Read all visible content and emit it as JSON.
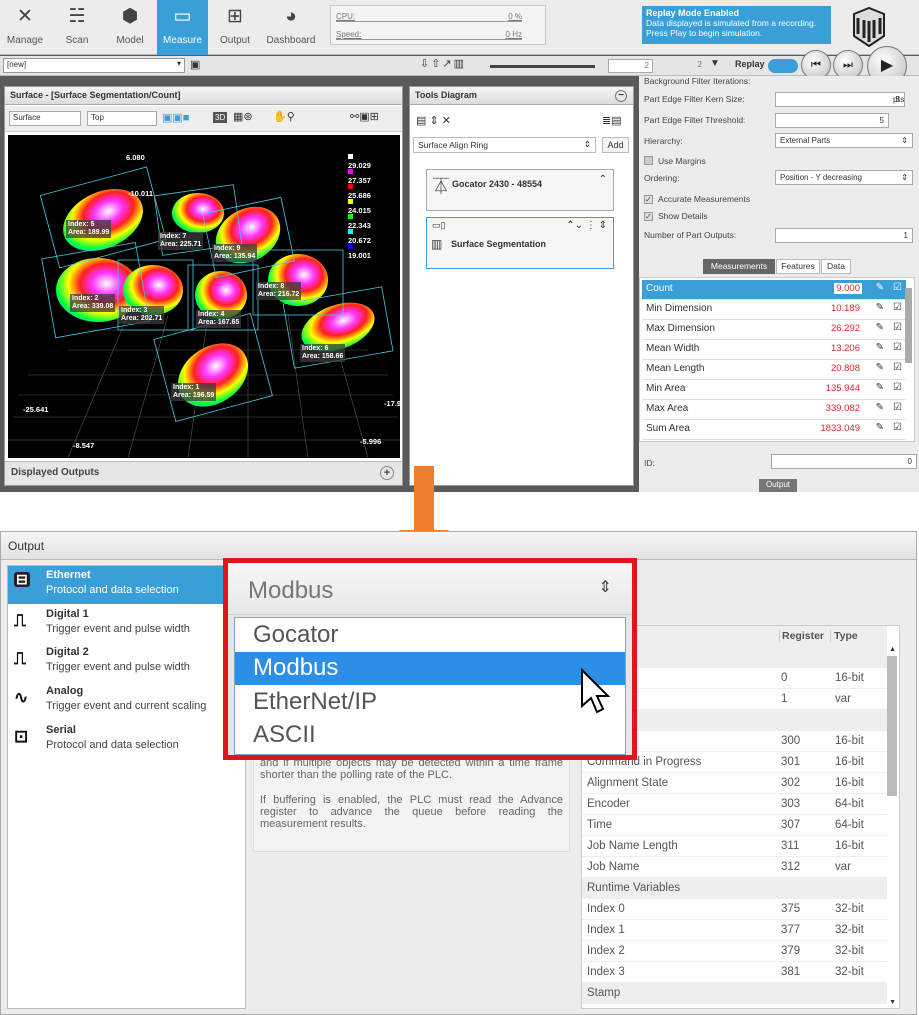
{
  "nav": [
    {
      "label": "Manage",
      "icon": "tools-icon"
    },
    {
      "label": "Scan",
      "icon": "scan-icon"
    },
    {
      "label": "Model",
      "icon": "model-icon"
    },
    {
      "label": "Measure",
      "icon": "measure-icon"
    },
    {
      "label": "Output",
      "icon": "output-icon"
    },
    {
      "label": "Dashboard",
      "icon": "dashboard-icon"
    }
  ],
  "stats": {
    "cpu_label": "CPU:",
    "cpu_value": "0 %",
    "speed_label": "Speed:",
    "speed_value": "0 Hz"
  },
  "replay": {
    "title": "Replay Mode Enabled",
    "message": "Data displayed is simulated from a recording. Press Play to begin simulation.",
    "toggle_label": "Replay"
  },
  "job": {
    "value": "[new]"
  },
  "frame": {
    "current": "2",
    "total": "2"
  },
  "viewer": {
    "title": "Surface - [Surface Segmentation/Count]",
    "source": "Surface",
    "view": "Top",
    "mode3d": "3D",
    "footer": "Displayed Outputs",
    "legend": [
      {
        "value": "29.029",
        "color": "#ffffff"
      },
      {
        "value": "27.357",
        "color": "#ff00ff"
      },
      {
        "value": "25.686",
        "color": "#ff0000"
      },
      {
        "value": "24.015",
        "color": "#ffff00"
      },
      {
        "value": "22.343",
        "color": "#00ff00"
      },
      {
        "value": "20.672",
        "color": "#00ffff"
      },
      {
        "value": "19.001",
        "color": "#0000ff"
      }
    ],
    "axes": {
      "top": "6.080",
      "upper_left": "-10.011",
      "left": "-25.641",
      "bottom_left": "-8.547",
      "bottom_right": "-5.996",
      "right": "-17.9"
    },
    "labels": [
      {
        "name": "Index: 5",
        "area": "Area: 189.99"
      },
      {
        "name": "Index: 7",
        "area": "Area: 225.71"
      },
      {
        "name": "Index: 9",
        "area": "Area: 135.94"
      },
      {
        "name": "Index: 8",
        "area": "Area: 216.72"
      },
      {
        "name": "Index: 2",
        "area": "Area: 339.08"
      },
      {
        "name": "Index: 3",
        "area": "Area: 202.71"
      },
      {
        "name": "Index: 4",
        "area": "Area: 167.65"
      },
      {
        "name": "Index: 6",
        "area": "Area: 158.66"
      },
      {
        "name": "Index: 1",
        "area": "Area: 196.59"
      }
    ]
  },
  "tools": {
    "title": "Tools Diagram",
    "tool_select": "Surface Align Ring",
    "add_label": "Add",
    "sensor": "Gocator 2430 - 48554",
    "tool": "Surface Segmentation"
  },
  "props": {
    "rows": [
      {
        "label": "Background Filter Iterations:",
        "value": ""
      },
      {
        "label": "Part Edge Filter Kern Size:",
        "value": "5",
        "unit": "pts"
      },
      {
        "label": "Part Edge Filter Threshold:",
        "value": "5"
      },
      {
        "label": "Hierarchy:",
        "value": "External Parts"
      },
      {
        "label": "Use Margins"
      },
      {
        "label": "Ordering:",
        "value": "Position - Y decreasing"
      },
      {
        "label": "Accurate Measurements"
      },
      {
        "label": "Show Details"
      },
      {
        "label": "Number of Part Outputs:",
        "value": "1"
      }
    ],
    "tabs": [
      "Measurements",
      "Features",
      "Data"
    ],
    "measurements": [
      {
        "name": "Count",
        "value": "9.000"
      },
      {
        "name": "Min Dimension",
        "value": "10.189"
      },
      {
        "name": "Max Dimension",
        "value": "26.292"
      },
      {
        "name": "Mean Width",
        "value": "13.206"
      },
      {
        "name": "Mean Length",
        "value": "20.808"
      },
      {
        "name": "Min Area",
        "value": "135.944"
      },
      {
        "name": "Max Area",
        "value": "339.082"
      },
      {
        "name": "Sum Area",
        "value": "1833.049"
      }
    ],
    "id_label": "ID:",
    "id_value": "0",
    "output_tab": "Output"
  },
  "output": {
    "title": "Output",
    "items": [
      {
        "title": "Ethernet",
        "desc": "Protocol and data selection",
        "icon": "ethernet-icon"
      },
      {
        "title": "Digital 1",
        "desc": "Trigger event and pulse width",
        "icon": "pulse-icon"
      },
      {
        "title": "Digital 2",
        "desc": "Trigger event and pulse width",
        "icon": "pulse-icon"
      },
      {
        "title": "Analog",
        "desc": "Trigger event and current scaling",
        "icon": "wave-icon"
      },
      {
        "title": "Serial",
        "desc": "Protocol and data selection",
        "icon": "serial-port-icon"
      }
    ],
    "description_1": "and if multiple objects may be detected within a time frame shorter than the polling rate of the PLC.",
    "description_2": "If buffering is enabled, the PLC must read the Advance register to advance the queue before reading the measurement results.",
    "table": {
      "headers": [
        "Register",
        "Type"
      ],
      "rows": [
        {
          "name": "",
          "reg": "",
          "type": "",
          "section": true
        },
        {
          "name": "d",
          "reg": "0",
          "type": "16-bit"
        },
        {
          "name": "s",
          "reg": "1",
          "type": "var"
        },
        {
          "name": "",
          "reg": "",
          "type": "",
          "section": true
        },
        {
          "name": "ate",
          "reg": "300",
          "type": "16-bit"
        },
        {
          "name": "Command in Progress",
          "reg": "301",
          "type": "16-bit"
        },
        {
          "name": "Alignment State",
          "reg": "302",
          "type": "16-bit"
        },
        {
          "name": "Encoder",
          "reg": "303",
          "type": "64-bit"
        },
        {
          "name": "Time",
          "reg": "307",
          "type": "64-bit"
        },
        {
          "name": "Job Name Length",
          "reg": "311",
          "type": "16-bit"
        },
        {
          "name": "Job Name",
          "reg": "312",
          "type": "var"
        },
        {
          "name": "Runtime Variables",
          "reg": "",
          "type": "",
          "section": true
        },
        {
          "name": "Index 0",
          "reg": "375",
          "type": "32-bit"
        },
        {
          "name": "Index 1",
          "reg": "377",
          "type": "32-bit"
        },
        {
          "name": "Index 2",
          "reg": "379",
          "type": "32-bit"
        },
        {
          "name": "Index 3",
          "reg": "381",
          "type": "32-bit"
        },
        {
          "name": "Stamp",
          "reg": "",
          "type": "",
          "section": true
        }
      ]
    }
  },
  "protocol_dropdown": {
    "selected": "Modbus",
    "options": [
      "Gocator",
      "Modbus",
      "EtherNet/IP",
      "ASCII"
    ],
    "highlighted": 1
  },
  "colors": {
    "accent": "#3a9ed9",
    "highlight_frame": "#e3151b",
    "arrow": "#ee7d2c"
  }
}
